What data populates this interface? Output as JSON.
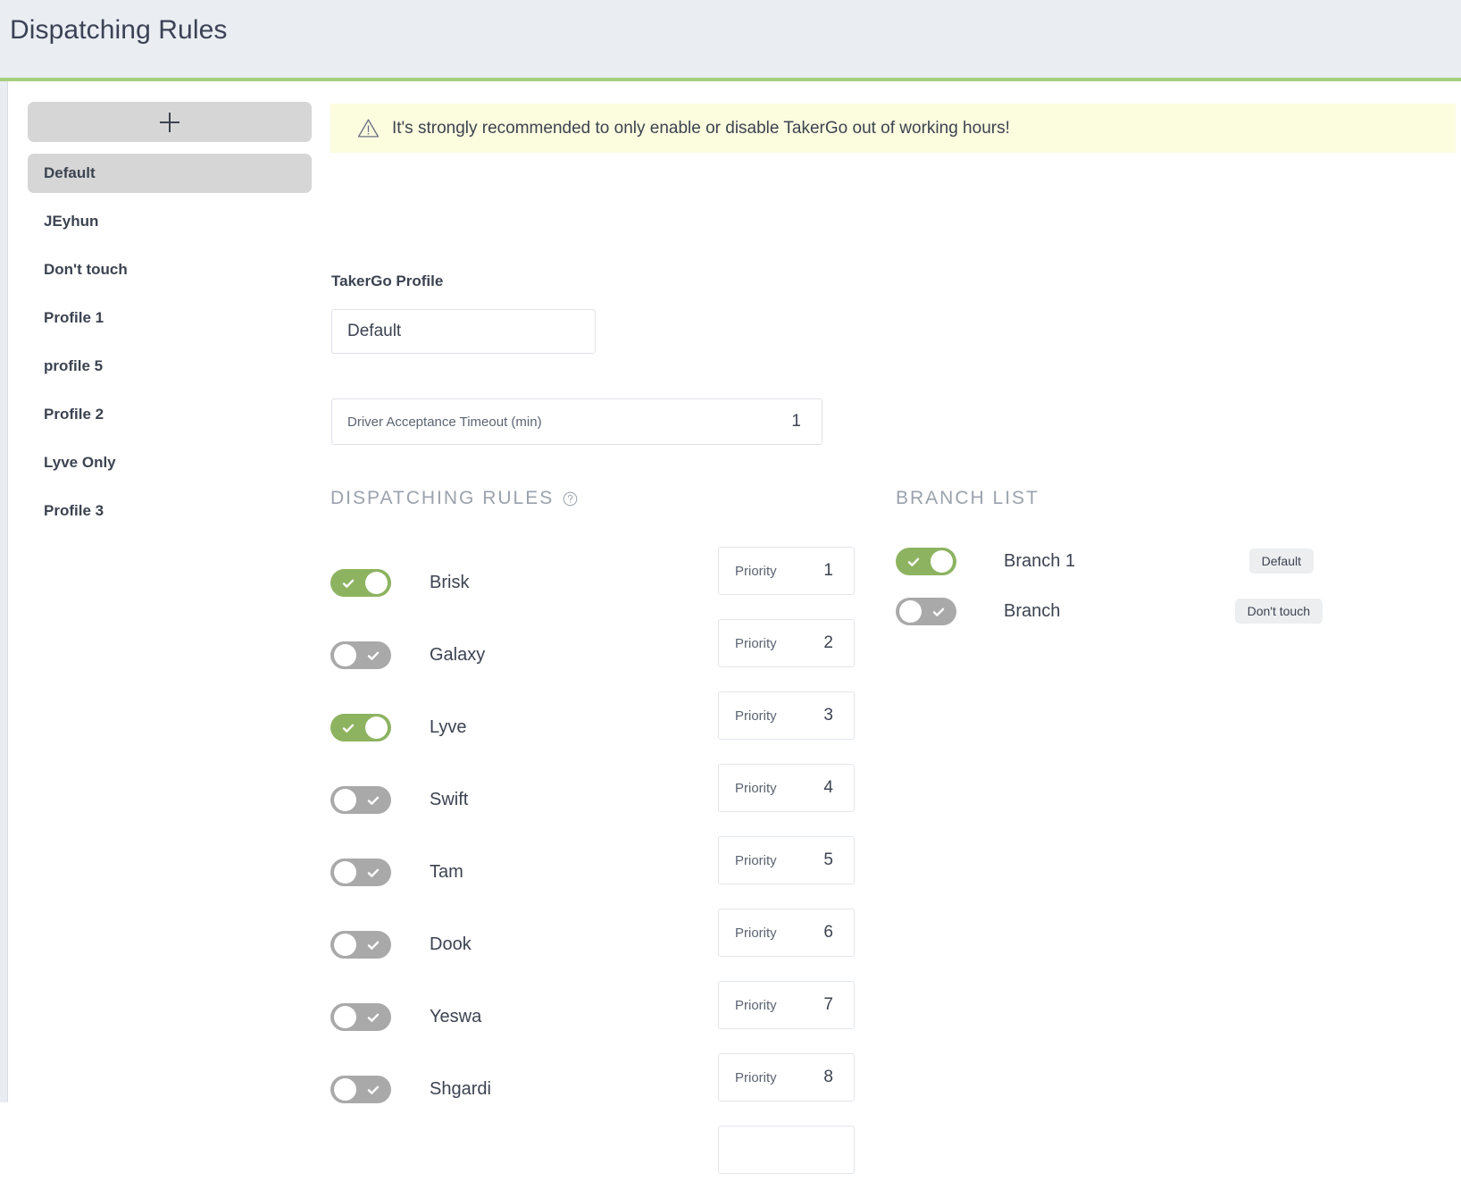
{
  "header": {
    "title": "Dispatching Rules",
    "background": "#eaeef2",
    "accent": "#a6cf7d"
  },
  "sidebar": {
    "add_button_icon": "plus-icon",
    "items": [
      {
        "label": "Default",
        "active": true
      },
      {
        "label": "JEyhun",
        "active": false
      },
      {
        "label": "Don't touch",
        "active": false
      },
      {
        "label": "Profile 1",
        "active": false
      },
      {
        "label": "profile 5",
        "active": false
      },
      {
        "label": "Profile 2",
        "active": false
      },
      {
        "label": "Lyve Only",
        "active": false
      },
      {
        "label": "Profile 3",
        "active": false
      }
    ]
  },
  "main": {
    "warning": {
      "icon": "warning-triangle-icon",
      "text": "It's strongly recommended to only enable or disable TakerGo out of working hours!",
      "background": "#fcfcdf"
    },
    "profile_field": {
      "label": "TakerGo Profile",
      "value": "Default"
    },
    "timeout_field": {
      "label": "Driver Acceptance Timeout (min)",
      "value": "1"
    },
    "rules_section": {
      "heading": "DISPATCHING RULES",
      "help_icon": "question-circle-icon",
      "priority_label": "Priority",
      "rules": [
        {
          "name": "Brisk",
          "enabled": true,
          "priority": "1"
        },
        {
          "name": "Galaxy",
          "enabled": false,
          "priority": "2"
        },
        {
          "name": "Lyve",
          "enabled": true,
          "priority": "3"
        },
        {
          "name": "Swift",
          "enabled": false,
          "priority": "4"
        },
        {
          "name": "Tam",
          "enabled": false,
          "priority": "5"
        },
        {
          "name": "Dook",
          "enabled": false,
          "priority": "6"
        },
        {
          "name": "Yeswa",
          "enabled": false,
          "priority": "7"
        },
        {
          "name": "Shgardi",
          "enabled": false,
          "priority": "8"
        }
      ]
    },
    "branch_section": {
      "heading": "BRANCH LIST",
      "branches": [
        {
          "name": "Branch 1",
          "enabled": true,
          "badge": "Default"
        },
        {
          "name": "Branch",
          "enabled": false,
          "badge": "Don't touch"
        }
      ]
    }
  },
  "colors": {
    "toggle_on": "#8db360",
    "toggle_off": "#a9a9a9",
    "text": "#3c4350",
    "muted": "#9ba2ac"
  }
}
